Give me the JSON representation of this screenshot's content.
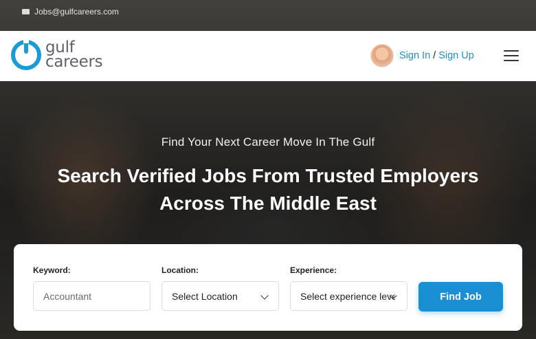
{
  "topbar": {
    "email": "Jobs@gulfcareers.com",
    "icon": "envelope-icon"
  },
  "header": {
    "logo": {
      "line1": "gulf",
      "line2": "careers"
    },
    "sign_in": "Sign In",
    "separator": "/",
    "sign_up": "Sign Up",
    "menu_icon": "hamburger-icon"
  },
  "hero": {
    "subtitle": "Find Your Next Career Move In The Gulf",
    "title_line1": "Search Verified Jobs From Trusted Employers",
    "title_line2": "Across The Middle East"
  },
  "search": {
    "keyword_label": "Keyword:",
    "keyword_placeholder": "Accountant",
    "location_label": "Location:",
    "location_value": "Select Location",
    "experience_label": "Experience:",
    "experience_value": "Select experience level",
    "submit_label": "Find Job"
  },
  "colors": {
    "accent": "#1a8fd3",
    "link": "#1a90c8",
    "logo_text": "#5f6368"
  }
}
